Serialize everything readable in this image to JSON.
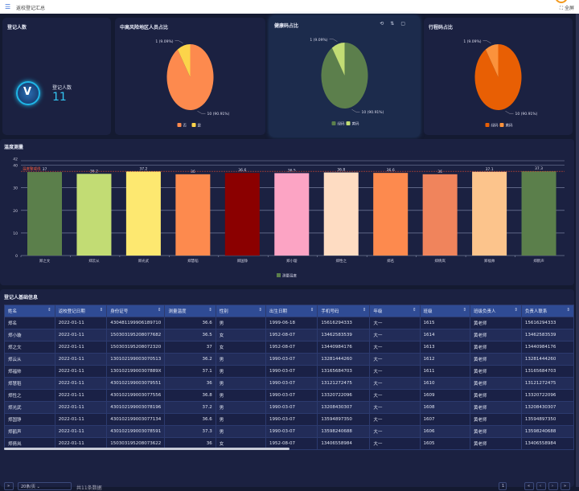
{
  "header": {
    "title": "返校登记汇总",
    "fullscreen": "全屏"
  },
  "count_card": {
    "title": "登记人数",
    "label": "登记人数",
    "value": "11"
  },
  "pies": [
    {
      "title": "中高风险地区人员占比",
      "slices": [
        {
          "name": "否",
          "value": 10,
          "label": "10 (90.91%)",
          "color": "#fd8a4e"
        },
        {
          "name": "是",
          "value": 1,
          "label": "1 (9.09%)",
          "color": "#fcd44a"
        }
      ]
    },
    {
      "title": "健康码占比",
      "slices": [
        {
          "name": "绿码",
          "value": 10,
          "label": "10 (90.91%)",
          "color": "#5c7f4c"
        },
        {
          "name": "黄码",
          "value": 1,
          "label": "1 (9.09%)",
          "color": "#c2dc74"
        }
      ]
    },
    {
      "title": "行程码占比",
      "slices": [
        {
          "name": "绿码",
          "value": 10,
          "label": "10 (90.91%)",
          "color": "#e85f04"
        },
        {
          "name": "黄码",
          "value": 1,
          "label": "1 (9.09%)",
          "color": "#fb923c"
        }
      ]
    }
  ],
  "chart_data": {
    "type": "bar",
    "title": "温度测量",
    "categories": [
      "郑之文",
      "郑云从",
      "郑光武",
      "郑慧稻",
      "郑国铮",
      "郑小璇",
      "郑性之",
      "郑名",
      "郑倩岚",
      "郑福帅",
      "郑鹤声"
    ],
    "series": [
      {
        "name": "测量温度",
        "values": [
          37,
          36.2,
          37.2,
          36,
          36.6,
          36.5,
          36.8,
          36.6,
          36,
          37.1,
          37.3
        ]
      }
    ],
    "colors": [
      "#5b7f4b",
      "#c2dc74",
      "#fde870",
      "#fd8a4e",
      "#8b0000",
      "#fca4c4",
      "#fedcc2",
      "#fd8a4e",
      "#f0845c",
      "#fcc48c",
      "#5b7f4b"
    ],
    "ylim": [
      0,
      42
    ],
    "yticks": [
      0,
      10,
      20,
      30,
      40,
      42
    ],
    "markline": {
      "label": "温度警戒线",
      "value": 37.3
    },
    "legend": "bottom",
    "grid": true
  },
  "table": {
    "title": "登记人基础信息",
    "columns": [
      "姓名",
      "返校登记日期",
      "身份证号",
      "测量温度",
      "性别",
      "出生日期",
      "手机号码",
      "年级",
      "班级",
      "班级负责人",
      "负责人联系"
    ],
    "rows": [
      [
        "郑名",
        "2022-01-11",
        "430481199906189710",
        "36.6",
        "男",
        "1999-06-18",
        "15616294333",
        "大一",
        "1615",
        "黄老师",
        "15616294333"
      ],
      [
        "郑小璇",
        "2022-01-11",
        "150303195208077682",
        "36.5",
        "女",
        "1952-08-07",
        "13462583539",
        "大一",
        "1614",
        "黄老师",
        "13462583539"
      ],
      [
        "郑之文",
        "2022-01-11",
        "150303195208072320",
        "37",
        "女",
        "1952-08-07",
        "13440984176",
        "大一",
        "1613",
        "黄老师",
        "13440984176"
      ],
      [
        "郑云从",
        "2022-01-11",
        "130102199003070513",
        "36.2",
        "男",
        "1990-03-07",
        "13281444260",
        "大一",
        "1612",
        "黄老师",
        "13281444260"
      ],
      [
        "郑福帅",
        "2022-01-11",
        "13010219900307889X",
        "37.1",
        "男",
        "1990-03-07",
        "13165684703",
        "大一",
        "1611",
        "黄老师",
        "13165684703"
      ],
      [
        "郑慧稻",
        "2022-01-11",
        "430102199003079551",
        "36",
        "男",
        "1990-03-07",
        "13121272475",
        "大一",
        "1610",
        "黄老师",
        "13121272475"
      ],
      [
        "郑性之",
        "2022-01-11",
        "430102199003077556",
        "36.8",
        "男",
        "1990-03-07",
        "13320722096",
        "大一",
        "1609",
        "黄老师",
        "13320722096"
      ],
      [
        "郑光武",
        "2022-01-11",
        "430102199003078196",
        "37.2",
        "男",
        "1990-03-07",
        "13208430307",
        "大一",
        "1608",
        "黄老师",
        "13208430307"
      ],
      [
        "郑国铮",
        "2022-01-11",
        "430102199003077134",
        "36.6",
        "男",
        "1990-03-07",
        "13594897350",
        "大一",
        "1607",
        "黄老师",
        "13594897350"
      ],
      [
        "郑鹤声",
        "2022-01-11",
        "430102199003078591",
        "37.3",
        "男",
        "1990-03-07",
        "13598240688",
        "大一",
        "1606",
        "黄老师",
        "13598240688"
      ],
      [
        "郑倩岚",
        "2022-01-11",
        "150303195208073622",
        "36",
        "女",
        "1952-08-07",
        "13406558984",
        "大一",
        "1605",
        "黄老师",
        "13406558984"
      ]
    ],
    "page_size": "20条/页",
    "total": "共11条数据",
    "current_page": "1"
  }
}
